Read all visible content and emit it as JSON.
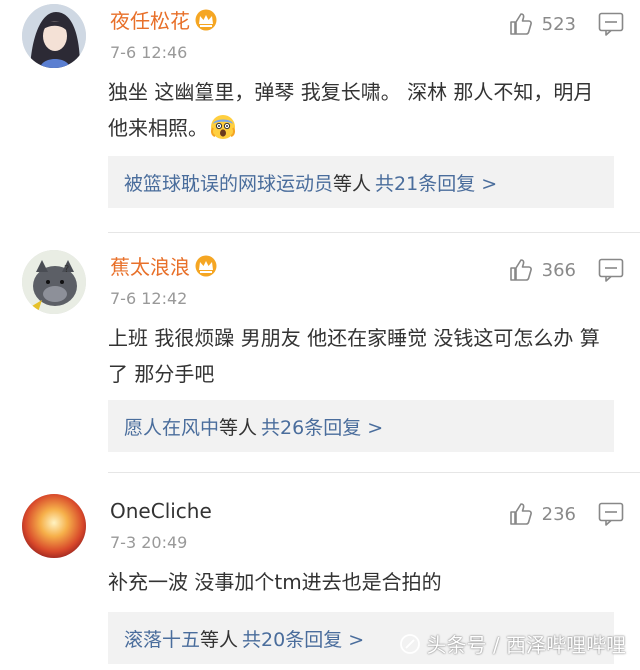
{
  "comments": [
    {
      "username": "夜任松花",
      "vip": true,
      "time": "7-6 12:46",
      "likes": "523",
      "content": "独坐 这幽篁里，弹琴 我复长啸。 深林 那人不知，明月 他来相照。",
      "emoji": "scared-face-emoji",
      "replies": {
        "user": "被篮球耽误的网球运动员",
        "etc": "等人",
        "total": "共21条回复 >"
      }
    },
    {
      "username": "蕉太浪浪",
      "vip": true,
      "time": "7-6 12:42",
      "likes": "366",
      "content": "上班 我很烦躁  男朋友 他还在家睡觉  没钱这可怎么办 算了 那分手吧",
      "replies": {
        "user": "愿人在风中",
        "etc": "等人",
        "total": "共26条回复 >"
      }
    },
    {
      "username": "OneCliche",
      "vip": false,
      "time": "7-3 20:49",
      "likes": "236",
      "content": "补充一波 没事加个tm进去也是合拍的",
      "replies": {
        "user": "滚落十五",
        "etc": "等人",
        "total": "共20条回复 >"
      }
    }
  ],
  "watermark": {
    "text": "头条号 / 西泽哔哩哔哩"
  },
  "colors": {
    "username": "#e8702a",
    "link": "#4a6d9c",
    "meta": "#999999",
    "reply_bg": "#f2f2f2"
  }
}
